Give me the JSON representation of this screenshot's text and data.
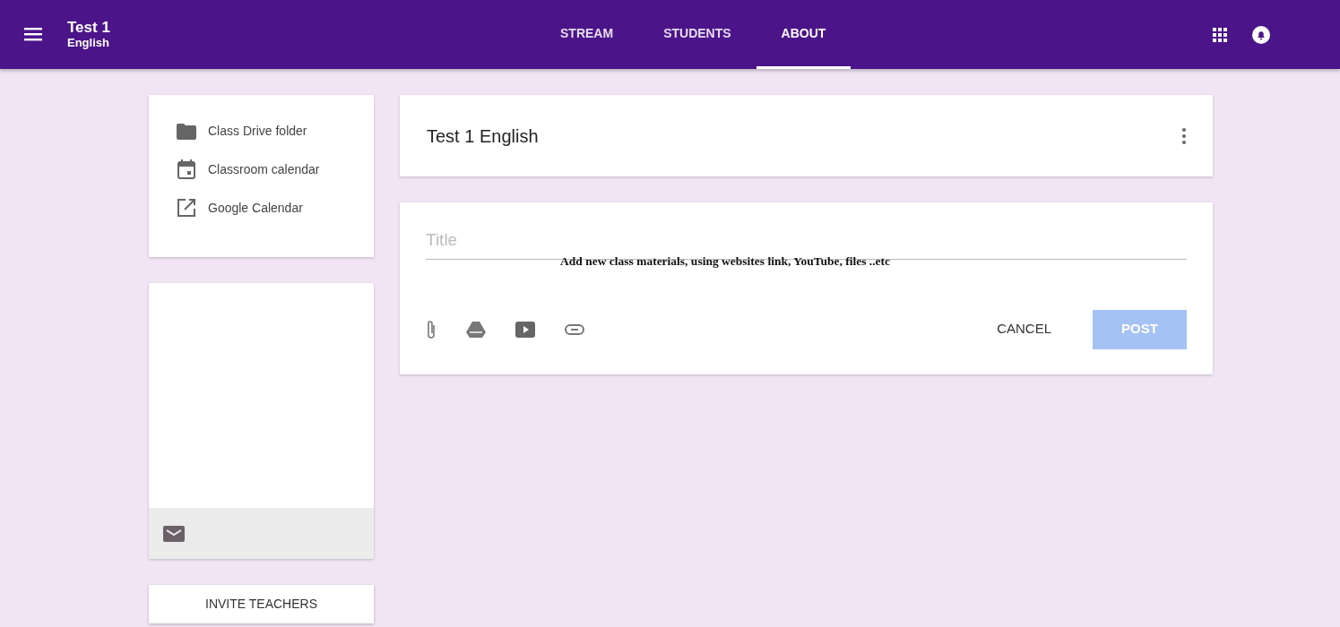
{
  "header": {
    "title": "Test 1",
    "subtitle": "English"
  },
  "tabs": [
    {
      "label": "STREAM",
      "selected": false
    },
    {
      "label": "STUDENTS",
      "selected": false
    },
    {
      "label": "ABOUT",
      "selected": true
    }
  ],
  "links": [
    {
      "label": "Class Drive folder",
      "kind": "folder"
    },
    {
      "label": "Classroom calendar",
      "kind": "calendar"
    },
    {
      "label": "Google Calendar",
      "kind": "external"
    }
  ],
  "invite_button": "INVITE TEACHERS",
  "class_card": {
    "title": "Test 1 English"
  },
  "composer": {
    "placeholder": "Title",
    "annotation": "Add new class materials, using websites link, YouTube, files ..etc",
    "cancel": "CANCEL",
    "post": {
      "label": "POST",
      "disabled": true
    }
  }
}
